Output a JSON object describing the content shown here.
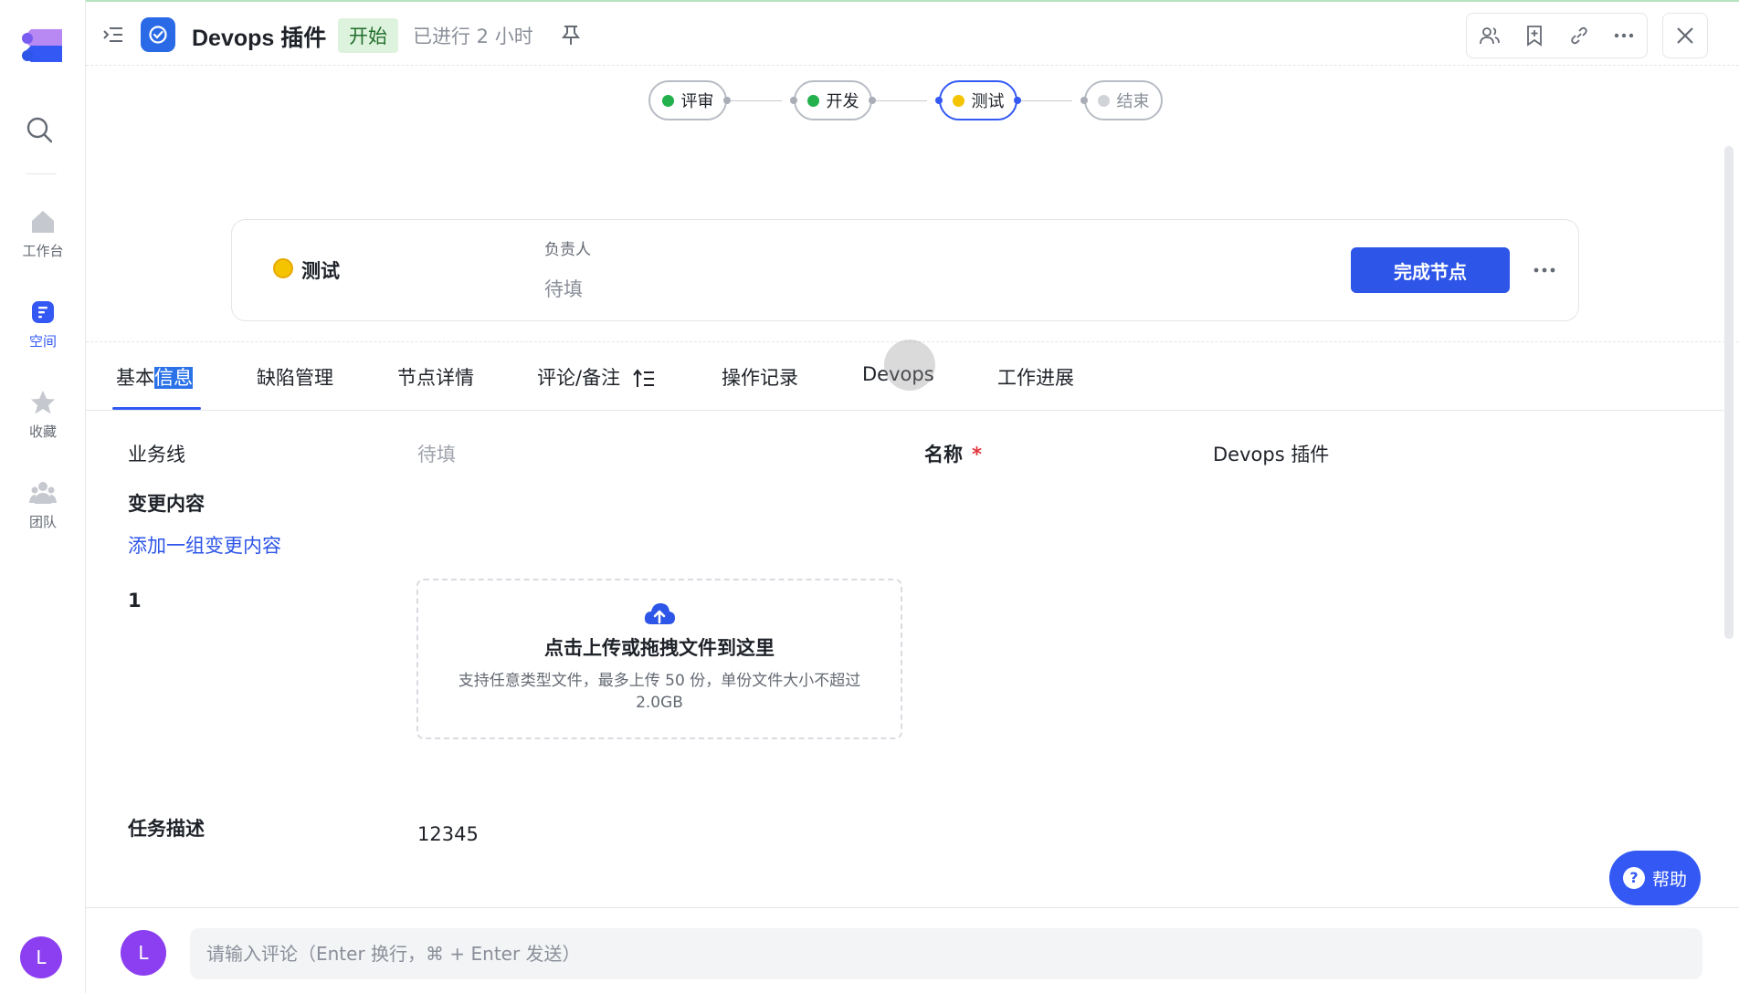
{
  "nav": {
    "items": [
      {
        "label": "工作台",
        "icon": "home-icon"
      },
      {
        "label": "空间",
        "icon": "space-icon"
      },
      {
        "label": "收藏",
        "icon": "star-icon"
      },
      {
        "label": "团队",
        "icon": "team-icon"
      }
    ],
    "user_initial": "L"
  },
  "header": {
    "title": "Devops 插件",
    "status": "开始",
    "elapsed": "已进行 2 小时"
  },
  "workflow": {
    "nodes": [
      {
        "label": "评审",
        "state": "done",
        "color": "#22b14c"
      },
      {
        "label": "开发",
        "state": "done",
        "color": "#22b14c"
      },
      {
        "label": "测试",
        "state": "active",
        "color": "#f5c400"
      },
      {
        "label": "结束",
        "state": "pending",
        "color": "#d0d3d8"
      }
    ]
  },
  "node_card": {
    "name": "测试",
    "owner_label": "负责人",
    "owner_value": "待填",
    "complete_button": "完成节点"
  },
  "tabs": {
    "basic_pre": "基本",
    "basic_sel": "信息",
    "defects": "缺陷管理",
    "node_detail": "节点详情",
    "comments": "评论/备注",
    "log": "操作记录",
    "devops": "Devops",
    "progress": "工作进展"
  },
  "form": {
    "business_line_label": "业务线",
    "business_line_value": "待填",
    "name_label": "名称",
    "name_required": "*",
    "name_value": "Devops 插件",
    "change_label": "变更内容",
    "add_change_link": "添加一组变更内容",
    "group_index": "1",
    "upload_title": "点击上传或拖拽文件到这里",
    "upload_hint": "支持任意类型文件，最多上传 50 份，单份文件大小不超过 2.0GB",
    "desc_label": "任务描述",
    "desc_value": "12345"
  },
  "help": {
    "label": "帮助",
    "icon": "?"
  },
  "comment": {
    "avatar_initial": "L",
    "placeholder": "请输入评论（Enter 换行，⌘ + Enter 发送）"
  },
  "colors": {
    "accent": "#3358f4",
    "status_bg": "#ddf3dd",
    "done": "#22b14c",
    "active": "#f5c400"
  }
}
